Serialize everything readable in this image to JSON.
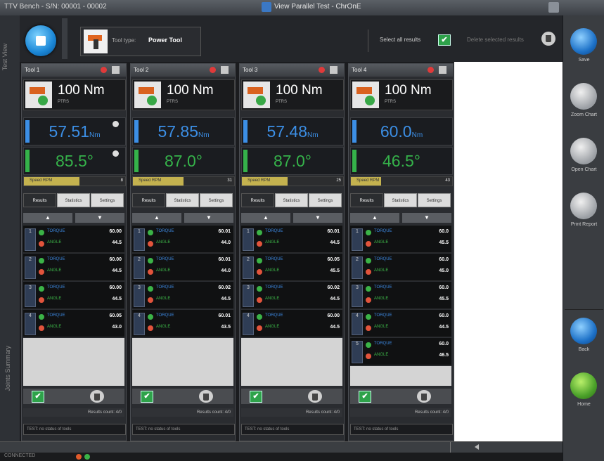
{
  "window": {
    "left_title": "TTV Bench - S/N: 00001 - 00002",
    "center_title": "View Parallel Test - ChrOnE"
  },
  "left_strip": {
    "top_label": "Test View",
    "bottom_label": "Joints Summary"
  },
  "toolbar": {
    "tool_type_label": "Tool type:",
    "tool_type_value": "Power Tool",
    "select_all_label": "Select all results",
    "select_all_checked": "✔",
    "delete_label": "Delete selected results"
  },
  "colors": {
    "torque_blue": "#3c8fe6",
    "angle_green": "#35b24a",
    "speed_bar": "#c4b24f"
  },
  "tabs": [
    "Results",
    "Statistics",
    "Settings"
  ],
  "arrows": {
    "up": "▲",
    "down": "▼"
  },
  "panels": [
    {
      "title": "Tool 1",
      "target": "100 Nm",
      "target_sub": "PTRS",
      "torque_value": "57.51",
      "torque_unit": "Nm",
      "angle_value": "85.5",
      "angle_unit": "°",
      "speed_label": "Speed RPM",
      "speed_value": "8",
      "speed_fill": 0.55,
      "results": [
        {
          "n": "1",
          "a": "TORQUE",
          "b": "ANGLE",
          "torque": "60.00",
          "angle": "44.5"
        },
        {
          "n": "2",
          "a": "TORQUE",
          "b": "ANGLE",
          "torque": "60.00",
          "angle": "44.5"
        },
        {
          "n": "3",
          "a": "TORQUE",
          "b": "ANGLE",
          "torque": "60.00",
          "angle": "44.5"
        },
        {
          "n": "4",
          "a": "TORQUE",
          "b": "ANGLE",
          "torque": "60.05",
          "angle": "43.0"
        }
      ],
      "results_count": "Results count: 4/0",
      "message": "TEST: no status of tools"
    },
    {
      "title": "Tool 2",
      "target": "100 Nm",
      "target_sub": "PTRS",
      "torque_value": "57.85",
      "torque_unit": "Nm",
      "angle_value": "87.0",
      "angle_unit": "°",
      "speed_label": "Speed RPM",
      "speed_value": "31",
      "speed_fill": 0.5,
      "results": [
        {
          "n": "1",
          "a": "TORQUE",
          "b": "ANGLE",
          "torque": "60.01",
          "angle": "44.0"
        },
        {
          "n": "2",
          "a": "TORQUE",
          "b": "ANGLE",
          "torque": "60.01",
          "angle": "44.0"
        },
        {
          "n": "3",
          "a": "TORQUE",
          "b": "ANGLE",
          "torque": "60.02",
          "angle": "44.5"
        },
        {
          "n": "4",
          "a": "TORQUE",
          "b": "ANGLE",
          "torque": "60.01",
          "angle": "43.5"
        }
      ],
      "results_count": "Results count: 4/0",
      "message": "TEST: no status of tools"
    },
    {
      "title": "Tool 3",
      "target": "100 Nm",
      "target_sub": "PTRS",
      "torque_value": "57.48",
      "torque_unit": "Nm",
      "angle_value": "87.0",
      "angle_unit": "°",
      "speed_label": "Speed RPM",
      "speed_value": "25",
      "speed_fill": 0.45,
      "results": [
        {
          "n": "1",
          "a": "TORQUE",
          "b": "ANGLE",
          "torque": "60.01",
          "angle": "44.5"
        },
        {
          "n": "2",
          "a": "TORQUE",
          "b": "ANGLE",
          "torque": "60.05",
          "angle": "45.5"
        },
        {
          "n": "3",
          "a": "TORQUE",
          "b": "ANGLE",
          "torque": "60.02",
          "angle": "44.5"
        },
        {
          "n": "4",
          "a": "TORQUE",
          "b": "ANGLE",
          "torque": "60.00",
          "angle": "44.5"
        }
      ],
      "results_count": "Results count: 4/0",
      "message": "TEST: no status of tools"
    },
    {
      "title": "Tool 4",
      "target": "100 Nm",
      "target_sub": "PTRS",
      "torque_value": "60.0",
      "torque_unit": "Nm",
      "angle_value": "46.5",
      "angle_unit": "°",
      "speed_label": "Speed RPM",
      "speed_value": "43",
      "speed_fill": 0.3,
      "results": [
        {
          "n": "1",
          "a": "TORQUE",
          "b": "ANGLE",
          "torque": "60.0",
          "angle": "45.5"
        },
        {
          "n": "2",
          "a": "TORQUE",
          "b": "ANGLE",
          "torque": "60.0",
          "angle": "45.0"
        },
        {
          "n": "3",
          "a": "TORQUE",
          "b": "ANGLE",
          "torque": "60.0",
          "angle": "45.5"
        },
        {
          "n": "4",
          "a": "TORQUE",
          "b": "ANGLE",
          "torque": "60.0",
          "angle": "44.5"
        },
        {
          "n": "5",
          "a": "TORQUE",
          "b": "ANGLE",
          "torque": "60.0",
          "angle": "46.5"
        }
      ],
      "results_count": "Results count: 4/0",
      "message": "TEST: no status of tools"
    }
  ],
  "right_sidebar": [
    {
      "label": "Save",
      "icon": "save-icon"
    },
    {
      "label": "Zoom Chart",
      "icon": "zoom-icon"
    },
    {
      "label": "Open Chart",
      "icon": "chart-icon"
    },
    {
      "label": "Print Report",
      "icon": "print-icon"
    },
    {
      "label": "Back",
      "icon": "back-icon"
    },
    {
      "label": "Home",
      "icon": "home-icon"
    }
  ],
  "status_bar": {
    "text": "CONNECTED"
  }
}
